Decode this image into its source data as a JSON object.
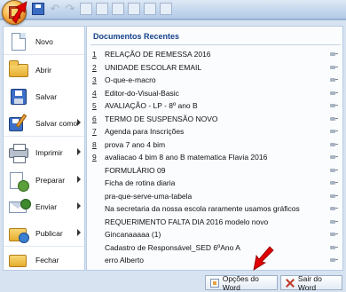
{
  "left_menu": [
    {
      "label": "Novo",
      "icon": "new-document-icon",
      "submenu": false
    },
    {
      "label": "Abrir",
      "icon": "open-folder-icon",
      "submenu": false
    },
    {
      "label": "Salvar",
      "icon": "save-disk-icon",
      "submenu": false
    },
    {
      "label": "Salvar como",
      "icon": "save-as-icon",
      "submenu": true
    },
    {
      "label": "Imprimir",
      "icon": "printer-icon",
      "submenu": true
    },
    {
      "label": "Preparar",
      "icon": "prepare-icon",
      "submenu": true
    },
    {
      "label": "Enviar",
      "icon": "send-icon",
      "submenu": true
    },
    {
      "label": "Publicar",
      "icon": "publish-icon",
      "submenu": true
    },
    {
      "label": "Fechar",
      "icon": "close-folder-icon",
      "submenu": false
    }
  ],
  "recent": {
    "title": "Documentos Recentes",
    "items": [
      {
        "num": "1",
        "name": "RELAÇÃO DE REMESSA 2016"
      },
      {
        "num": "2",
        "name": "UNIDADE ESCOLAR EMAIL"
      },
      {
        "num": "3",
        "name": "O-que-e-macro"
      },
      {
        "num": "4",
        "name": "Editor-do-Visual-Basic"
      },
      {
        "num": "5",
        "name": "AVALIAÇÃO - LP - 8º ano B"
      },
      {
        "num": "6",
        "name": "TERMO DE SUSPENSÃO NOVO"
      },
      {
        "num": "7",
        "name": "Agenda para Inscrições"
      },
      {
        "num": "8",
        "name": "prova 7 ano 4 bim"
      },
      {
        "num": "9",
        "name": "avaliacao 4 bim 8 ano B matematica Flavia 2016"
      },
      {
        "num": "",
        "name": "FORMULÁRIO 09"
      },
      {
        "num": "",
        "name": "Ficha de rotina diaria"
      },
      {
        "num": "",
        "name": "pra-que-serve-uma-tabela"
      },
      {
        "num": "",
        "name": "Na secretaria da nossa escola raramente usamos gráficos"
      },
      {
        "num": "",
        "name": "REQUERIMENTO FALTA DIA  2016 modelo novo"
      },
      {
        "num": "",
        "name": "Gincanaaaaa (1)"
      },
      {
        "num": "",
        "name": "Cadastro de Responsável_SED 6ºAno A"
      },
      {
        "num": "",
        "name": "erro Alberto"
      }
    ]
  },
  "footer": {
    "options_label": "Opções do Word",
    "exit_label": "Sair do Word"
  },
  "colors": {
    "accent": "#15428b",
    "annotation_arrow": "#e00000"
  }
}
